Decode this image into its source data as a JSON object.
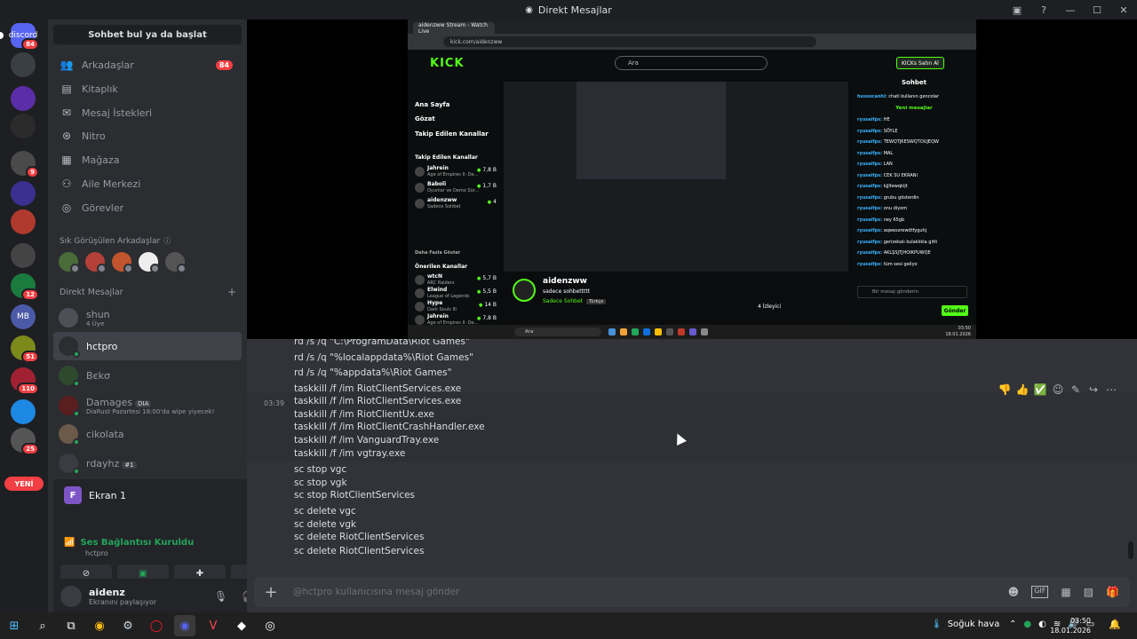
{
  "window": {
    "title": "Direkt Mesajlar"
  },
  "guilds": [
    {
      "label": "discord",
      "badge": "84",
      "color": "#5865f2"
    },
    {
      "label": "",
      "badge": "",
      "color": "#3a3f44"
    },
    {
      "label": "",
      "badge": "",
      "color": "#5b2ea8"
    },
    {
      "label": "",
      "badge": "",
      "color": "#2b2b2b"
    },
    {
      "label": "",
      "badge": "9",
      "color": "#4a4a4a"
    },
    {
      "label": "",
      "badge": "",
      "color": "#3b2f8f"
    },
    {
      "label": "",
      "badge": "",
      "color": "#b03a2e"
    },
    {
      "label": "",
      "badge": "",
      "color": "#444"
    },
    {
      "label": "",
      "badge": "12",
      "color": "#1b7a3e"
    },
    {
      "label": "MB",
      "badge": "",
      "color": "#4b5aa8"
    },
    {
      "label": "",
      "badge": "51",
      "color": "#7c8a1c"
    },
    {
      "label": "",
      "badge": "110",
      "color": "#a02232"
    },
    {
      "label": "",
      "badge": "",
      "color": "#1e88e5"
    },
    {
      "label": "",
      "badge": "25",
      "color": "#555"
    }
  ],
  "new_pill": "YENİ",
  "sidebar": {
    "search": "Sohbet bul ya da başlat",
    "nav": [
      {
        "label": "Arkadaşlar",
        "icon": "friends-icon",
        "count": "84"
      },
      {
        "label": "Kitaplık",
        "icon": "library-icon",
        "count": ""
      },
      {
        "label": "Mesaj İstekleri",
        "icon": "mail-icon",
        "count": ""
      },
      {
        "label": "Nitro",
        "icon": "nitro-icon",
        "count": ""
      },
      {
        "label": "Mağaza",
        "icon": "shop-icon",
        "count": ""
      },
      {
        "label": "Aile Merkezi",
        "icon": "family-icon",
        "count": ""
      },
      {
        "label": "Görevler",
        "icon": "quests-icon",
        "count": ""
      }
    ],
    "frequent_label": "Sık Görüşülen Arkadaşlar",
    "dm_label": "Direkt Mesajlar",
    "dms": [
      {
        "name": "shun",
        "sub": "4 Üye",
        "tag": ""
      },
      {
        "name": "hctpro",
        "sub": "",
        "tag": ""
      },
      {
        "name": "Bєkσ",
        "sub": "",
        "tag": ""
      },
      {
        "name": "Damages",
        "sub": "DiaRust Pazartesi 18:00'da wipe yiyecek!",
        "tag": "DIA"
      },
      {
        "name": "cikolata",
        "sub": "",
        "tag": ""
      },
      {
        "name": "rdayhz",
        "sub": "",
        "tag": "#1"
      }
    ]
  },
  "stream_panel": {
    "title": "Ekran 1",
    "avatar_letter": "F",
    "voice_status": "Ses Bağlantısı Kuruldu",
    "voice_channel": "hctpro"
  },
  "user": {
    "name": "aidenz",
    "status": "Ekranını paylaşıyor"
  },
  "shared_screen": {
    "tab_title": "aidenzww Stream - Watch Live",
    "url": "kick.com/aidenzww",
    "logo": "KICK",
    "search_placeholder": "Ara",
    "buy": "KICKs Satın Al",
    "side_nav": [
      "Ana Sayfa",
      "Gözat",
      "Takip Edilen Kanallar"
    ],
    "followed_header": "Takip Edilen Kanallar",
    "followed": [
      {
        "name": "Jahrein",
        "game": "Age of Empires II: De...",
        "viewers": "7,8 B"
      },
      {
        "name": "Baboli",
        "game": "Oyunlar ve Demo Sür...",
        "viewers": "1,7 B"
      },
      {
        "name": "aidenzww",
        "game": "Sadece Sohbet",
        "viewers": "4"
      }
    ],
    "more": "Daha Fazla Göster",
    "recommended_header": "Önerilen Kanallar",
    "recommended": [
      {
        "name": "wtcN",
        "game": "ARC Raiders",
        "viewers": "5,7 B"
      },
      {
        "name": "Elwind",
        "game": "League of Legends",
        "viewers": "5,5 B"
      },
      {
        "name": "Hype",
        "game": "Dark Souls III",
        "viewers": "14 B"
      },
      {
        "name": "Jahrein",
        "game": "Age of Empires II: De...",
        "viewers": "7,8 B"
      }
    ],
    "channel": "aidenzww",
    "stream_title": "sadece sohbettttt",
    "category": "Sadece Sohbet",
    "language": "Türkçe",
    "viewers_label": "4 İzleyici",
    "chat_title": "Sohbet",
    "chat_first": {
      "user": "hussocanhl:",
      "text": "chati kullanın gencolar"
    },
    "new_messages": "Yeni mesajlar",
    "chat": [
      {
        "user": "ryusaifps:",
        "text": "HE"
      },
      {
        "user": "ryusaifps:",
        "text": "SÖYLE"
      },
      {
        "user": "ryusaifps:",
        "text": "TEWQTJKESWQTOUJEQW"
      },
      {
        "user": "ryusaifps:",
        "text": "MAL"
      },
      {
        "user": "ryusaifps:",
        "text": "LAN"
      },
      {
        "user": "ryusaifps:",
        "text": "CEK SU EKRANI"
      },
      {
        "user": "ryusaifps:",
        "text": "kjjltewqkljt"
      },
      {
        "user": "ryusaifps:",
        "text": "grubu gösterdin"
      },
      {
        "user": "ryusaifps:",
        "text": "onu diyom"
      },
      {
        "user": "ryusaifps:",
        "text": "ney 65gb"
      },
      {
        "user": "ryusaifps:",
        "text": "aqweszrewdtfyguhj"
      },
      {
        "user": "ryusaifps:",
        "text": "gerizekalı kulaklıkla gitti"
      },
      {
        "user": "ryusaifps:",
        "text": "AKLŞSJTJHOIKPUWQE"
      },
      {
        "user": "ryusaifps:",
        "text": "tüm sesi geliyo"
      }
    ],
    "chat_input": "Bir mesaj gönderin",
    "send": "Gönder",
    "win_search": "Ara",
    "win_time": "03:50",
    "win_date": "18.01.2026"
  },
  "messages": {
    "time": "03:39",
    "lines_a": [
      "rd /s /q \"C:\\ProgramData\\Riot Games\"",
      "rd /s /q \"%localappdata%\\Riot Games\"",
      "rd /s /q \"%appdata%\\Riot Games\"",
      "taskkill /f /im RiotClientServices.exe"
    ],
    "lines_b": [
      "taskkill /f /im RiotClientServices.exe",
      "taskkill /f /im RiotClientUx.exe",
      "taskkill /f /im RiotClientCrashHandler.exe",
      "taskkill /f /im VanguardTray.exe",
      "taskkill /f /im vgtray.exe"
    ],
    "lines_c": [
      "sc stop vgc",
      "sc stop vgk",
      "sc stop RiotClientServices"
    ],
    "lines_d": [
      "sc delete vgc",
      "sc delete vgk",
      "sc delete RiotClientServices"
    ],
    "lines_e": [
      "sc delete RiotClientServices"
    ]
  },
  "composer": {
    "placeholder": "@hctpro kullanıcısına mesaj gönder"
  },
  "taskbar": {
    "weather": "Soğuk hava",
    "time": "03:50",
    "date": "18.01.2026"
  }
}
